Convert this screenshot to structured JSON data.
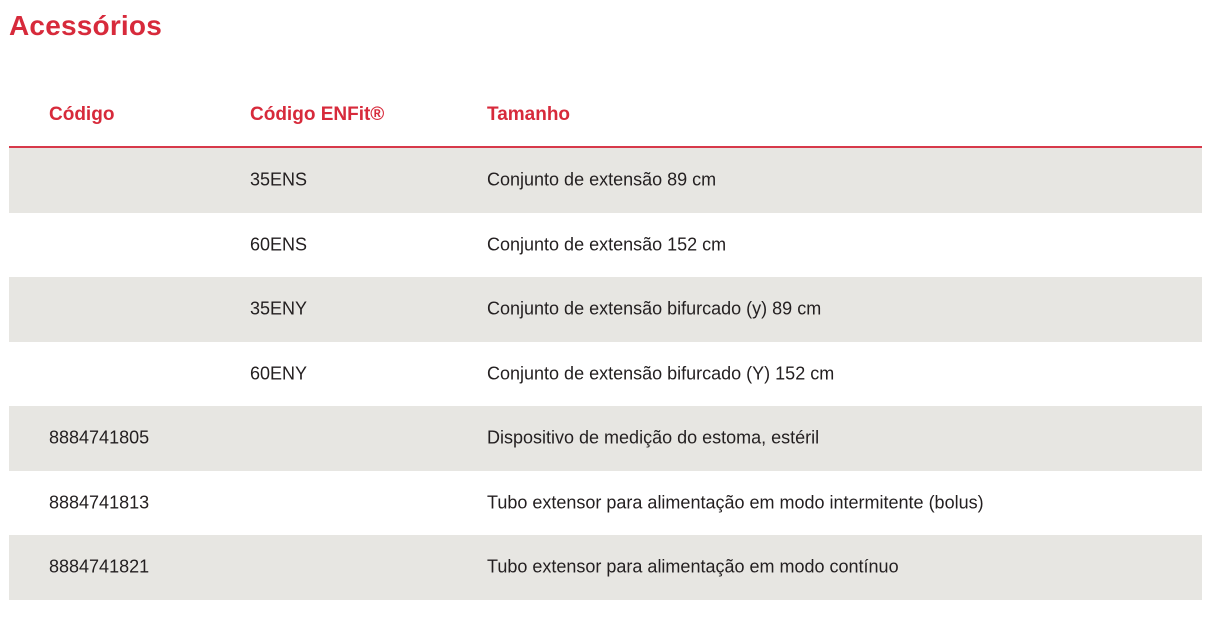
{
  "title": "Acessórios",
  "table": {
    "headers": [
      "Código",
      "Código ENFit®",
      "Tamanho"
    ],
    "rows": [
      {
        "codigo": "",
        "enfit": "35ENS",
        "tamanho": "Conjunto de extensão 89 cm"
      },
      {
        "codigo": "",
        "enfit": "60ENS",
        "tamanho": "Conjunto de extensão 152 cm"
      },
      {
        "codigo": "",
        "enfit": "35ENY",
        "tamanho": "Conjunto de extensão bifurcado (y) 89 cm"
      },
      {
        "codigo": "",
        "enfit": "60ENY",
        "tamanho": "Conjunto de extensão bifurcado (Y) 152 cm"
      },
      {
        "codigo": "8884741805",
        "enfit": "",
        "tamanho": "Dispositivo de medição do estoma, estéril"
      },
      {
        "codigo": "8884741813",
        "enfit": "",
        "tamanho": "Tubo extensor para alimentação em modo intermitente (bolus)"
      },
      {
        "codigo": "8884741821",
        "enfit": "",
        "tamanho": "Tubo extensor para alimentação em modo contínuo"
      }
    ]
  },
  "colors": {
    "accent": "#d72a3b",
    "row_shade": "#e7e6e2",
    "text": "#231f20"
  }
}
